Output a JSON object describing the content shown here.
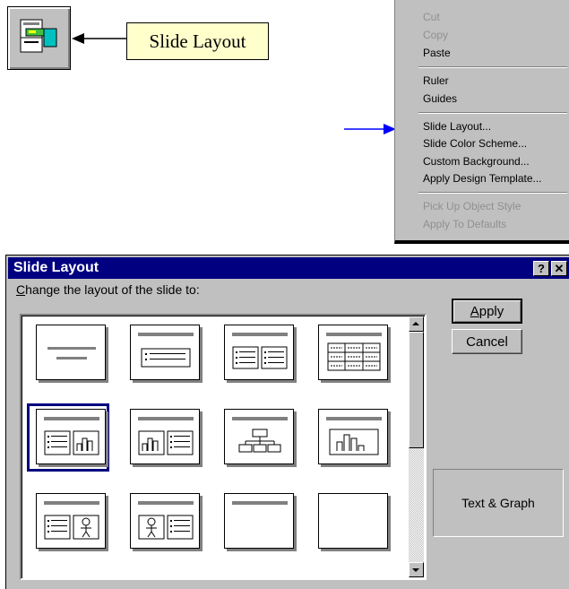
{
  "toolbar": {
    "callout_label": "Slide Layout",
    "button_icon": "slide-layout-icon"
  },
  "context_menu": {
    "items": [
      {
        "label": "Cut",
        "enabled": false
      },
      {
        "label": "Copy",
        "enabled": false
      },
      {
        "label": "Paste",
        "enabled": true
      },
      {
        "label": "Ruler",
        "enabled": true
      },
      {
        "label": "Guides",
        "enabled": true
      },
      {
        "label": "Slide Layout...",
        "enabled": true
      },
      {
        "label": "Slide Color Scheme...",
        "enabled": true
      },
      {
        "label": "Custom Background...",
        "enabled": true
      },
      {
        "label": "Apply Design Template...",
        "enabled": true
      },
      {
        "label": "Pick Up Object Style",
        "enabled": false
      },
      {
        "label": "Apply To Defaults",
        "enabled": false
      }
    ]
  },
  "dialog": {
    "title": "Slide Layout",
    "help_label": "?",
    "close_label": "✕",
    "prompt_hotkey": "C",
    "prompt_rest": "hange the layout of the slide to:",
    "apply_hotkey": "A",
    "apply_rest": "pply",
    "cancel_label": "Cancel",
    "preview_label": "Text & Graph",
    "selected_layout": "text-and-graph",
    "layouts": [
      "title",
      "bulleted-list",
      "two-column-text",
      "table",
      "text-and-graph",
      "graph-and-text",
      "organization-chart",
      "graph",
      "text-and-clip-art",
      "clip-art-and-text",
      "title-only",
      "blank"
    ]
  },
  "colors": {
    "titlebar": "#000080",
    "callout_bg": "#ffffcc",
    "arrow": "#0000ff"
  }
}
